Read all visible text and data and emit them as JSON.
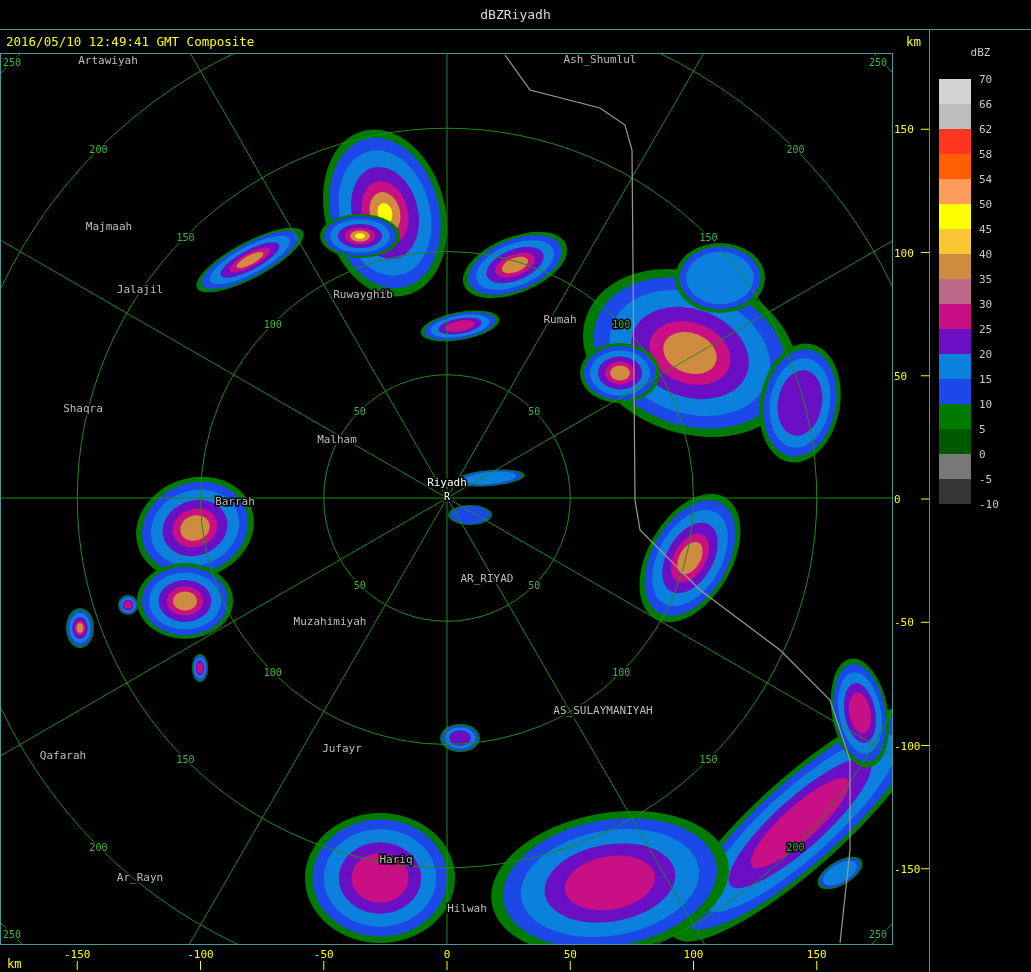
{
  "window": {
    "title": "dBZRiyadh"
  },
  "header": {
    "timestamp": "2016/05/10 12:49:41 GMT Composite",
    "unit": "km"
  },
  "map": {
    "range_rings": [
      {
        "labels": [
          "50",
          "50",
          "50",
          "50"
        ]
      },
      {
        "labels": [
          "100",
          "100",
          "100",
          "100"
        ]
      },
      {
        "labels": [
          "150",
          "150",
          "150",
          "150"
        ]
      },
      {
        "labels": [
          "200",
          "200",
          "200",
          "200"
        ]
      },
      {
        "labels": [
          "250",
          "250",
          "250",
          "250"
        ]
      }
    ],
    "places": [
      {
        "name": "Artawiyah",
        "kind": "town"
      },
      {
        "name": "Ash_Shumlul",
        "kind": "town"
      },
      {
        "name": "Majmaah",
        "kind": "town"
      },
      {
        "name": "Jalajil",
        "kind": "town"
      },
      {
        "name": "Ruwayghib",
        "kind": "town"
      },
      {
        "name": "Rumah",
        "kind": "town"
      },
      {
        "name": "Shaqra",
        "kind": "town"
      },
      {
        "name": "Malham",
        "kind": "town"
      },
      {
        "name": "Riyadh",
        "kind": "radar_site",
        "marker": "R"
      },
      {
        "name": "Barrah",
        "kind": "town"
      },
      {
        "name": "AR_RIYAD",
        "kind": "town"
      },
      {
        "name": "Muzahimiyah",
        "kind": "town"
      },
      {
        "name": "AS_SULAYMANIYAH",
        "kind": "town"
      },
      {
        "name": "Jufayr",
        "kind": "town"
      },
      {
        "name": "Qafarah",
        "kind": "town"
      },
      {
        "name": "Hariq",
        "kind": "town"
      },
      {
        "name": "Ar_Rayn",
        "kind": "town"
      },
      {
        "name": "Hilwah",
        "kind": "town"
      }
    ]
  },
  "y_axis": {
    "ticks": [
      "150",
      "100",
      "50",
      "0",
      "-50",
      "-100",
      "-150"
    ]
  },
  "x_axis": {
    "unit": "km",
    "ticks": [
      "-150",
      "-100",
      "-50",
      "0",
      "50",
      "100",
      "150"
    ]
  },
  "legend": {
    "title": "dBZ",
    "bins": [
      {
        "color": "#d3d3d3"
      },
      {
        "color": "#bebebe"
      },
      {
        "color": "#ff3520"
      },
      {
        "color": "#ff5f00"
      },
      {
        "color": "#ff9c5a"
      },
      {
        "color": "#ffff00"
      },
      {
        "color": "#f8c731"
      },
      {
        "color": "#cf8b40"
      },
      {
        "color": "#bd6888"
      },
      {
        "color": "#c80f84"
      },
      {
        "color": "#6b0fc5"
      },
      {
        "color": "#0b80dc"
      },
      {
        "color": "#1c48e8"
      },
      {
        "color": "#007b00"
      },
      {
        "color": "#005900"
      },
      {
        "color": "#787878"
      },
      {
        "color": "#363636"
      }
    ],
    "scale_labels": [
      "70",
      "66",
      "62",
      "58",
      "54",
      "50",
      "45",
      "40",
      "35",
      "30",
      "25",
      "20",
      "15",
      "10",
      "5",
      "0",
      "-5",
      "-10"
    ]
  }
}
